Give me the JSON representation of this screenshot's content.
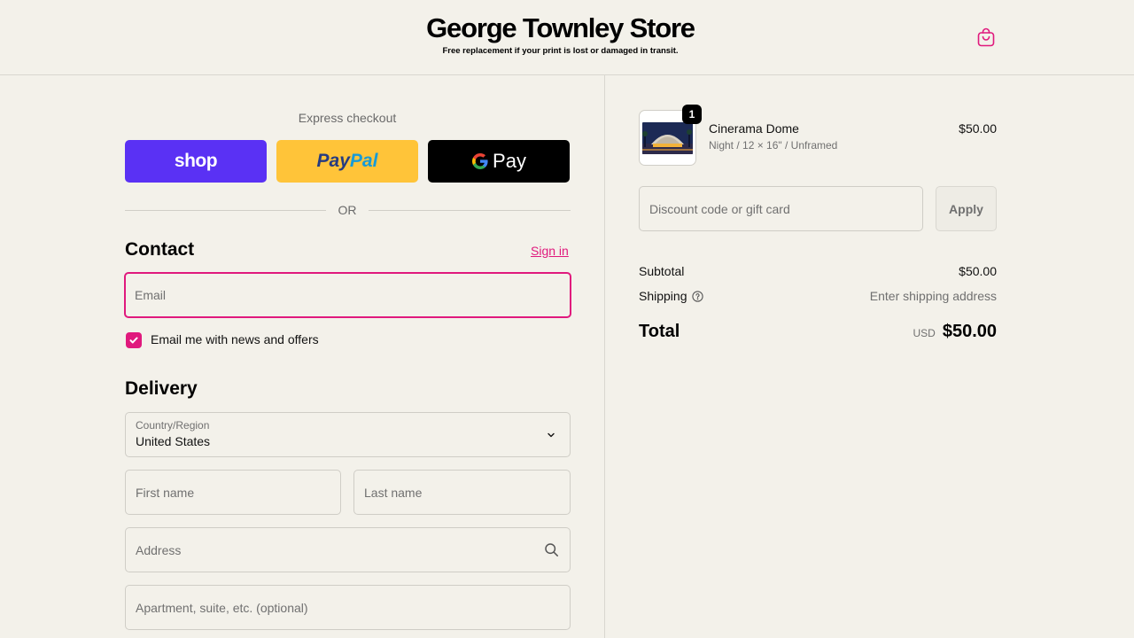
{
  "header": {
    "store_name": "George Townley Store",
    "tagline": "Free replacement if your print is lost or damaged in transit.",
    "cart_icon": "shopping-bag-icon"
  },
  "express": {
    "label": "Express checkout",
    "shop_label": "shop",
    "paypal_part1": "Pay",
    "paypal_part2": "Pal",
    "gpay_g": "G",
    "gpay_label": "Pay",
    "or_label": "OR"
  },
  "contact": {
    "title": "Contact",
    "sign_in": "Sign in",
    "email_placeholder": "Email",
    "newsletter_label": "Email me with news and offers",
    "newsletter_checked": true
  },
  "delivery": {
    "title": "Delivery",
    "country_label": "Country/Region",
    "country_value": "United States",
    "first_name_placeholder": "First name",
    "last_name_placeholder": "Last name",
    "address_placeholder": "Address",
    "apartment_placeholder": "Apartment, suite, etc. (optional)"
  },
  "order": {
    "item": {
      "quantity": "1",
      "name": "Cinerama Dome",
      "variant": "Night / 12 × 16\" / Unframed",
      "price": "$50.00"
    },
    "discount_placeholder": "Discount code or gift card",
    "apply_label": "Apply",
    "subtotal_label": "Subtotal",
    "subtotal_value": "$50.00",
    "shipping_label": "Shipping",
    "shipping_value": "Enter shipping address",
    "total_label": "Total",
    "currency": "USD",
    "total_value": "$50.00"
  },
  "colors": {
    "accent": "#e0197d",
    "background": "#f3f1ea",
    "shop_purple": "#5a31f4",
    "paypal_yellow": "#ffc439"
  }
}
